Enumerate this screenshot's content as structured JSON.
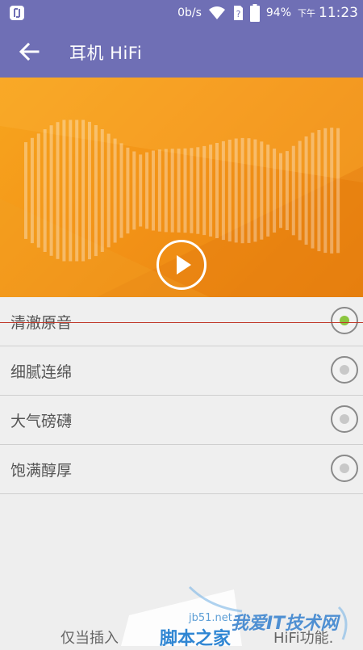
{
  "status_bar": {
    "speed": "0b/s",
    "battery": "94%",
    "period": "下午",
    "time": "11:23",
    "icons": [
      "app-notification-icon",
      "wifi-icon",
      "sim-card-icon",
      "battery-icon"
    ]
  },
  "app_bar": {
    "title": "耳机 HiFi",
    "back_icon": "arrow-left-icon"
  },
  "banner": {
    "play_icon": "play-icon",
    "colors": {
      "top": "#f7a51e",
      "bottom": "#e8810e"
    }
  },
  "options": [
    {
      "label": "清澈原音",
      "selected": true
    },
    {
      "label": "细腻连绵",
      "selected": false
    },
    {
      "label": "大气磅礴",
      "selected": false
    },
    {
      "label": "饱满醇厚",
      "selected": false
    }
  ],
  "footer": {
    "note_start": "仅当插入",
    "note_end": "HiFi功能."
  },
  "watermark": {
    "site": "jb51.net",
    "name": "脚本之家",
    "brand": "我爱IT技术网"
  },
  "colors": {
    "accent": "#6f6fb5",
    "selected": "#8cc63f"
  }
}
